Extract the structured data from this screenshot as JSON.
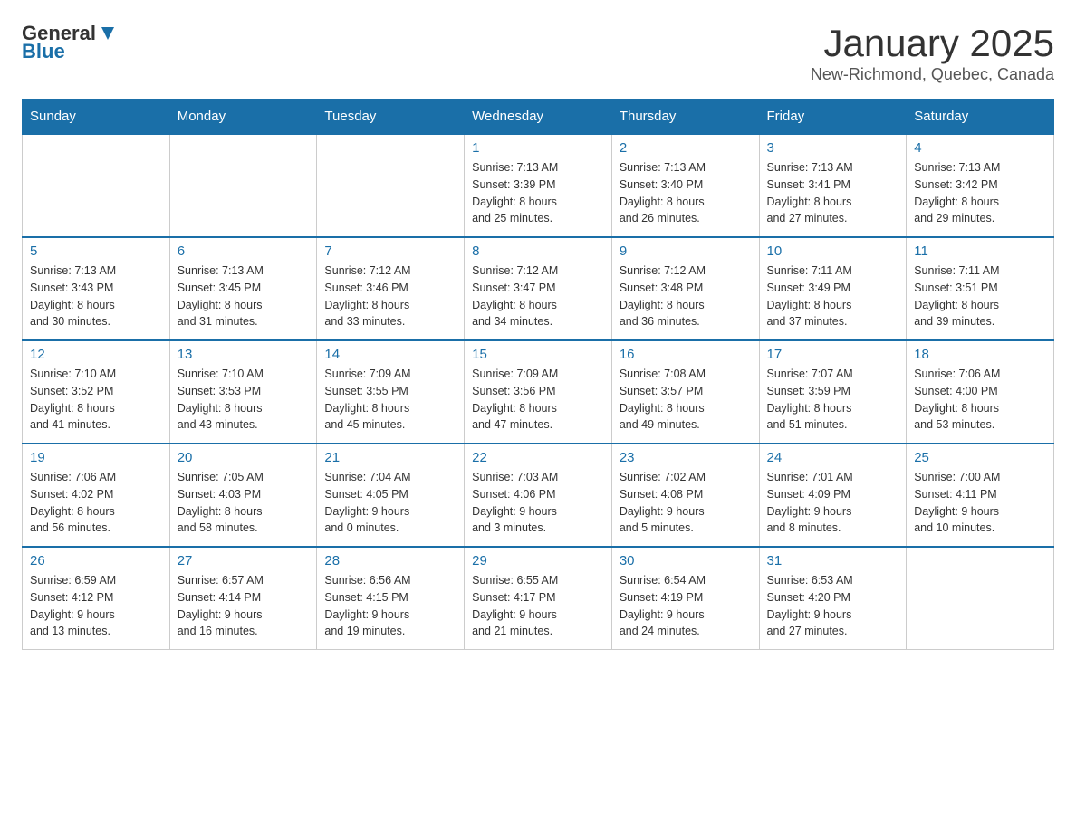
{
  "header": {
    "logo": {
      "general": "General",
      "blue": "Blue"
    },
    "title": "January 2025",
    "location": "New-Richmond, Quebec, Canada"
  },
  "days_of_week": [
    "Sunday",
    "Monday",
    "Tuesday",
    "Wednesday",
    "Thursday",
    "Friday",
    "Saturday"
  ],
  "weeks": [
    [
      {
        "day": "",
        "info": ""
      },
      {
        "day": "",
        "info": ""
      },
      {
        "day": "",
        "info": ""
      },
      {
        "day": "1",
        "info": "Sunrise: 7:13 AM\nSunset: 3:39 PM\nDaylight: 8 hours\nand 25 minutes."
      },
      {
        "day": "2",
        "info": "Sunrise: 7:13 AM\nSunset: 3:40 PM\nDaylight: 8 hours\nand 26 minutes."
      },
      {
        "day": "3",
        "info": "Sunrise: 7:13 AM\nSunset: 3:41 PM\nDaylight: 8 hours\nand 27 minutes."
      },
      {
        "day": "4",
        "info": "Sunrise: 7:13 AM\nSunset: 3:42 PM\nDaylight: 8 hours\nand 29 minutes."
      }
    ],
    [
      {
        "day": "5",
        "info": "Sunrise: 7:13 AM\nSunset: 3:43 PM\nDaylight: 8 hours\nand 30 minutes."
      },
      {
        "day": "6",
        "info": "Sunrise: 7:13 AM\nSunset: 3:45 PM\nDaylight: 8 hours\nand 31 minutes."
      },
      {
        "day": "7",
        "info": "Sunrise: 7:12 AM\nSunset: 3:46 PM\nDaylight: 8 hours\nand 33 minutes."
      },
      {
        "day": "8",
        "info": "Sunrise: 7:12 AM\nSunset: 3:47 PM\nDaylight: 8 hours\nand 34 minutes."
      },
      {
        "day": "9",
        "info": "Sunrise: 7:12 AM\nSunset: 3:48 PM\nDaylight: 8 hours\nand 36 minutes."
      },
      {
        "day": "10",
        "info": "Sunrise: 7:11 AM\nSunset: 3:49 PM\nDaylight: 8 hours\nand 37 minutes."
      },
      {
        "day": "11",
        "info": "Sunrise: 7:11 AM\nSunset: 3:51 PM\nDaylight: 8 hours\nand 39 minutes."
      }
    ],
    [
      {
        "day": "12",
        "info": "Sunrise: 7:10 AM\nSunset: 3:52 PM\nDaylight: 8 hours\nand 41 minutes."
      },
      {
        "day": "13",
        "info": "Sunrise: 7:10 AM\nSunset: 3:53 PM\nDaylight: 8 hours\nand 43 minutes."
      },
      {
        "day": "14",
        "info": "Sunrise: 7:09 AM\nSunset: 3:55 PM\nDaylight: 8 hours\nand 45 minutes."
      },
      {
        "day": "15",
        "info": "Sunrise: 7:09 AM\nSunset: 3:56 PM\nDaylight: 8 hours\nand 47 minutes."
      },
      {
        "day": "16",
        "info": "Sunrise: 7:08 AM\nSunset: 3:57 PM\nDaylight: 8 hours\nand 49 minutes."
      },
      {
        "day": "17",
        "info": "Sunrise: 7:07 AM\nSunset: 3:59 PM\nDaylight: 8 hours\nand 51 minutes."
      },
      {
        "day": "18",
        "info": "Sunrise: 7:06 AM\nSunset: 4:00 PM\nDaylight: 8 hours\nand 53 minutes."
      }
    ],
    [
      {
        "day": "19",
        "info": "Sunrise: 7:06 AM\nSunset: 4:02 PM\nDaylight: 8 hours\nand 56 minutes."
      },
      {
        "day": "20",
        "info": "Sunrise: 7:05 AM\nSunset: 4:03 PM\nDaylight: 8 hours\nand 58 minutes."
      },
      {
        "day": "21",
        "info": "Sunrise: 7:04 AM\nSunset: 4:05 PM\nDaylight: 9 hours\nand 0 minutes."
      },
      {
        "day": "22",
        "info": "Sunrise: 7:03 AM\nSunset: 4:06 PM\nDaylight: 9 hours\nand 3 minutes."
      },
      {
        "day": "23",
        "info": "Sunrise: 7:02 AM\nSunset: 4:08 PM\nDaylight: 9 hours\nand 5 minutes."
      },
      {
        "day": "24",
        "info": "Sunrise: 7:01 AM\nSunset: 4:09 PM\nDaylight: 9 hours\nand 8 minutes."
      },
      {
        "day": "25",
        "info": "Sunrise: 7:00 AM\nSunset: 4:11 PM\nDaylight: 9 hours\nand 10 minutes."
      }
    ],
    [
      {
        "day": "26",
        "info": "Sunrise: 6:59 AM\nSunset: 4:12 PM\nDaylight: 9 hours\nand 13 minutes."
      },
      {
        "day": "27",
        "info": "Sunrise: 6:57 AM\nSunset: 4:14 PM\nDaylight: 9 hours\nand 16 minutes."
      },
      {
        "day": "28",
        "info": "Sunrise: 6:56 AM\nSunset: 4:15 PM\nDaylight: 9 hours\nand 19 minutes."
      },
      {
        "day": "29",
        "info": "Sunrise: 6:55 AM\nSunset: 4:17 PM\nDaylight: 9 hours\nand 21 minutes."
      },
      {
        "day": "30",
        "info": "Sunrise: 6:54 AM\nSunset: 4:19 PM\nDaylight: 9 hours\nand 24 minutes."
      },
      {
        "day": "31",
        "info": "Sunrise: 6:53 AM\nSunset: 4:20 PM\nDaylight: 9 hours\nand 27 minutes."
      },
      {
        "day": "",
        "info": ""
      }
    ]
  ]
}
